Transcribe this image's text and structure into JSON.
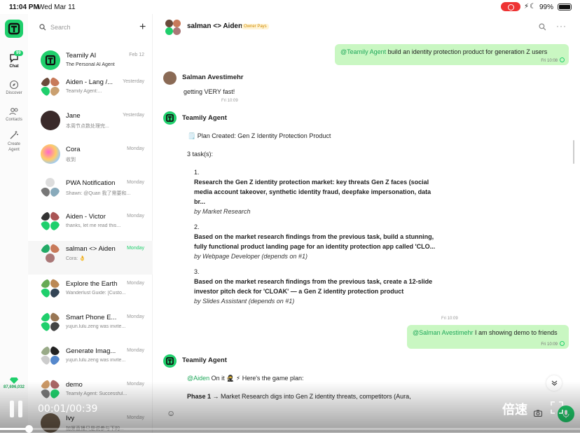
{
  "status": {
    "time": "11:04 PM",
    "date": "Wed Mar 11",
    "battery": "99%"
  },
  "rail": {
    "items": [
      {
        "label": "Chat",
        "badge": "99"
      },
      {
        "label": "Discover"
      },
      {
        "label": "Contacts"
      },
      {
        "label": "Create Agent"
      }
    ],
    "gems": "87,696,032"
  },
  "search": {
    "placeholder": "Search"
  },
  "conversations": [
    {
      "name": "Teamily AI",
      "time": "Feb 12",
      "preview": "The Personal AI Agent"
    },
    {
      "name": "Aiden - Lang /...",
      "time": "Yesterday",
      "preview": "Teamily Agent:..."
    },
    {
      "name": "Jane",
      "time": "Yesterday",
      "preview": "本周节点数处理完..."
    },
    {
      "name": "Cora",
      "time": "Monday",
      "preview": "收到"
    },
    {
      "name": "PWA Notification",
      "time": "Monday",
      "preview": "Shawn: @Quan 我了需要和..."
    },
    {
      "name": "Aiden - Victor",
      "time": "Monday",
      "preview": "thanks, let me read this..."
    },
    {
      "name": "salman <> Aiden",
      "time": "Monday",
      "preview": "Cora: 👌"
    },
    {
      "name": "Explore the Earth",
      "time": "Monday",
      "preview": "Wanderlust Guide: [Custo..."
    },
    {
      "name": "Smart Phone E...",
      "time": "Monday",
      "preview": "yujun.lulu.zeng was invite..."
    },
    {
      "name": "Generate Imag...",
      "time": "Monday",
      "preview": "yujun.lulu.zeng was invite..."
    },
    {
      "name": "demo",
      "time": "Monday",
      "preview": "Teamily Agent: Successful..."
    },
    {
      "name": "Ivy",
      "time": "Monday",
      "preview": "加第直播只是说参与下的..."
    }
  ],
  "chat": {
    "title": "salman <> Aiden",
    "owner_badge": "Owner Pays",
    "msg1": {
      "mention": "@Teamily Agent",
      "text": " build an identity protection product for generation Z users",
      "time": "Fri 10:08"
    },
    "msg2": {
      "sender": "Salman Avestimehr",
      "text": "getting VERY fast!",
      "time": "Fri 10:09"
    },
    "msg3": {
      "sender": "Teamily Agent",
      "plan_title": "Plan Created: Gen Z Identity Protection Product",
      "task_count": "3 task(s):",
      "tasks": [
        {
          "num": "1.",
          "line1": "Research the Gen Z identity protection market: key threats Gen Z faces (social",
          "line2": "media account takeover, synthetic identity fraud, deepfake impersonation, data",
          "line3": "br...",
          "by": "by Market Research"
        },
        {
          "num": "2.",
          "line1": "Based on the market research findings from the previous task, build a stunning,",
          "line2": "fully functional product landing page for an identity protection app called 'CLO...",
          "line3": "",
          "by": "by Webpage Developer (depends on #1)"
        },
        {
          "num": "3.",
          "line1": "Based on the market research findings from the previous task, create a 12-slide",
          "line2": "investor pitch deck for 'CLOAK' — a Gen Z identity protection product",
          "line3": "",
          "by": "by Slides Assistant (depends on #1)"
        }
      ]
    },
    "sys_time": "Fri 10:09",
    "msg4": {
      "mention": "@Salman Avestimehr",
      "text": " I am showing demo to friends",
      "time": "Fri 10:09"
    },
    "msg5": {
      "sender": "Teamily Agent",
      "mention": "@Aiden",
      "line1": " On it 🥷 ⚡ Here's the game plan:",
      "phase_label": "Phase 1",
      "phase_text": " → Market Research digs into Gen Z identity threats, competitors (Aura,"
    }
  },
  "video": {
    "time": "00:01/00:39",
    "speed": "倍速",
    "progress": 0.05
  },
  "colors": {
    "brand": "#1fcf6c",
    "bubble": "#c9f7c2"
  }
}
